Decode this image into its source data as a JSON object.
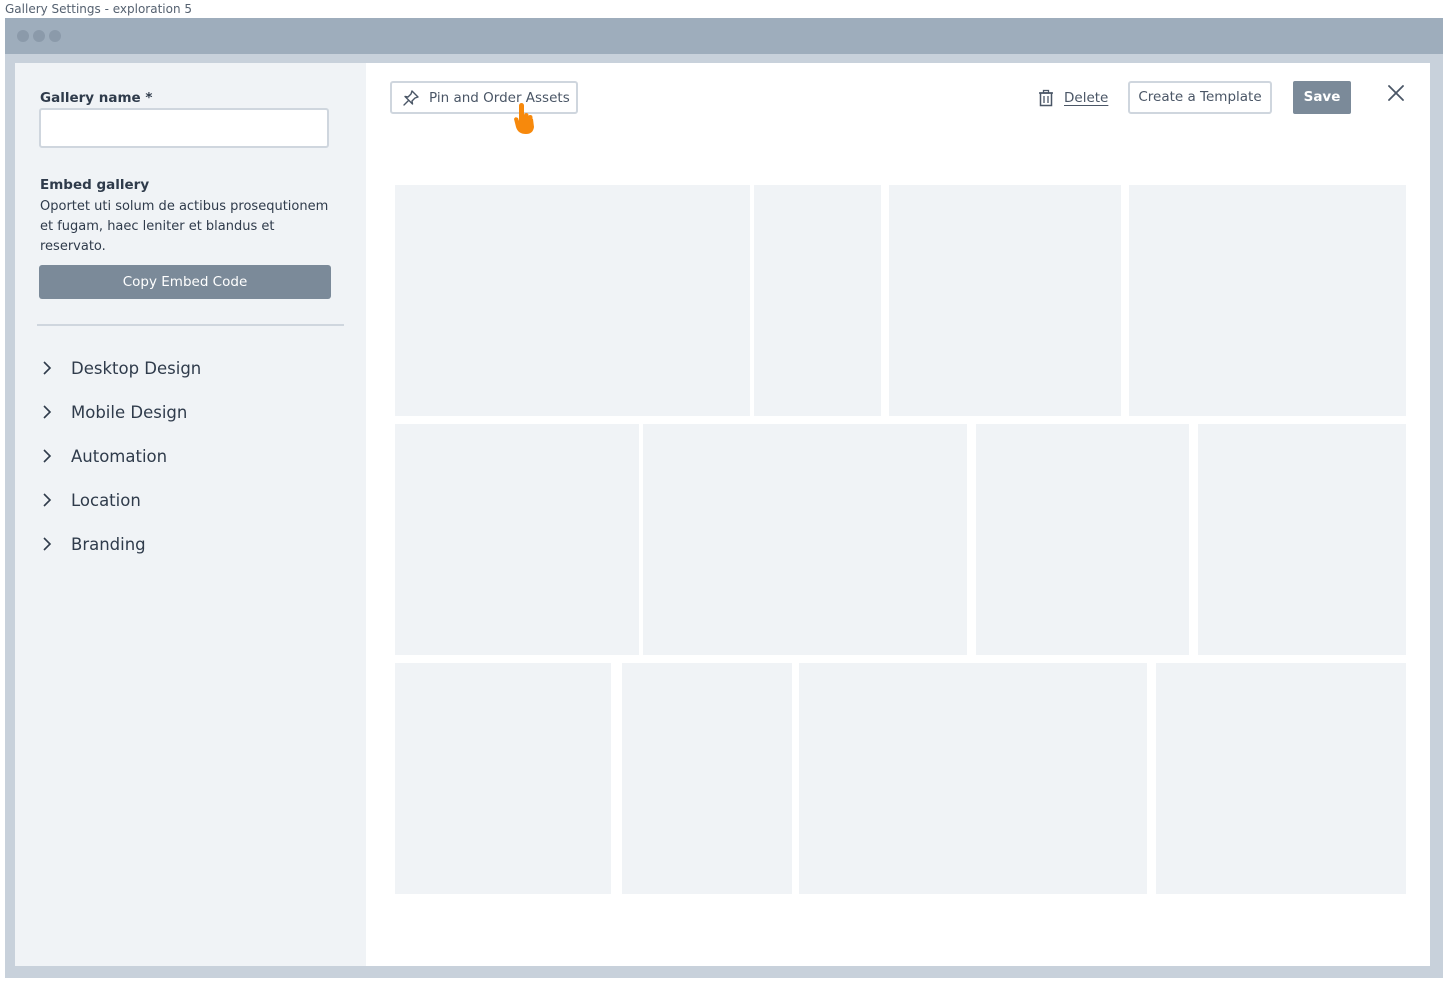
{
  "frame_title": "Gallery Settings - exploration 5",
  "sidebar": {
    "gallery_name_label": "Gallery name *",
    "gallery_name_value": "",
    "embed_title": "Embed gallery",
    "embed_description": "Oportet uti solum de actibus prosequtionem et fugam, haec leniter et blandus et reservato.",
    "copy_button": "Copy Embed Code",
    "sections": [
      {
        "label": "Desktop Design",
        "icon": "chevron-right-icon"
      },
      {
        "label": "Mobile Design",
        "icon": "chevron-right-icon"
      },
      {
        "label": "Automation",
        "icon": "chevron-right-icon"
      },
      {
        "label": "Location",
        "icon": "chevron-right-icon"
      },
      {
        "label": "Branding",
        "icon": "chevron-right-icon"
      }
    ]
  },
  "toolbar": {
    "pin_label": "Pin and Order Assets",
    "pin_icon": "pin-icon",
    "delete_label": "Delete",
    "delete_icon": "trash-icon",
    "template_label": "Create a Template",
    "save_label": "Save",
    "close_icon": "close-icon"
  },
  "colors": {
    "primary_button": "#7b8a99",
    "cursor_accent": "#f7890c",
    "placeholder_tile": "#f0f3f6",
    "window_chrome": "#9eadbc"
  }
}
